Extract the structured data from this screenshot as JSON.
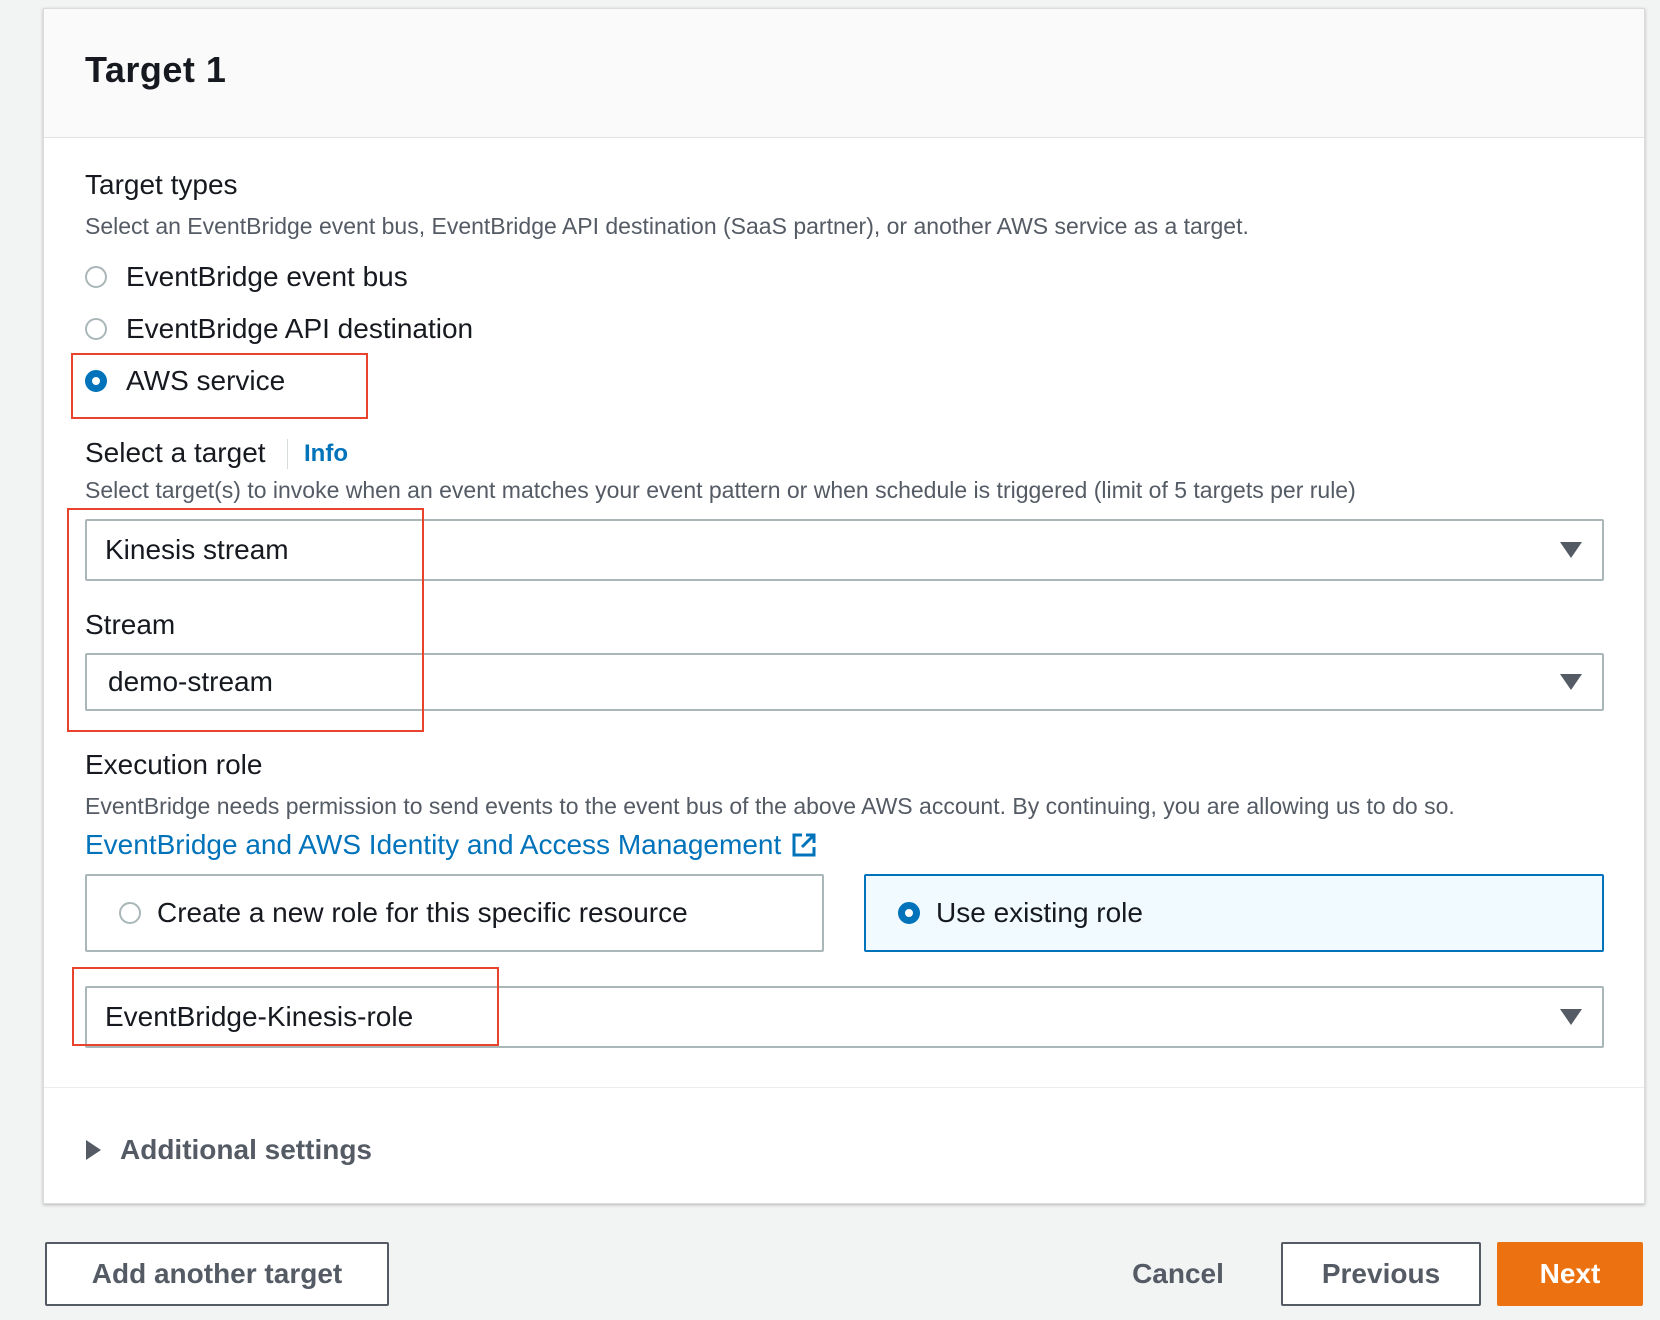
{
  "panel": {
    "title": "Target 1"
  },
  "target_types": {
    "label": "Target types",
    "description": "Select an EventBridge event bus, EventBridge API destination (SaaS partner), or another AWS service as a target.",
    "options": [
      {
        "label": "EventBridge event bus",
        "checked": false
      },
      {
        "label": "EventBridge API destination",
        "checked": false
      },
      {
        "label": "AWS service",
        "checked": true
      }
    ]
  },
  "select_target": {
    "label": "Select a target",
    "info_link": "Info",
    "description": "Select target(s) to invoke when an event matches your event pattern or when schedule is triggered (limit of 5 targets per rule)",
    "value": "Kinesis stream"
  },
  "stream": {
    "label": "Stream",
    "value": "demo-stream"
  },
  "execution_role": {
    "label": "Execution role",
    "description": "EventBridge needs permission to send events to the event bus of the above AWS account. By continuing, you are allowing us to do so.",
    "iam_link": "EventBridge and AWS Identity and Access Management",
    "tiles": [
      {
        "label": "Create a new role for this specific resource",
        "checked": false
      },
      {
        "label": "Use existing role",
        "checked": true
      }
    ],
    "role_value": "EventBridge-Kinesis-role"
  },
  "additional_settings": {
    "label": "Additional settings"
  },
  "footer": {
    "add_target": "Add another target",
    "cancel": "Cancel",
    "previous": "Previous",
    "next": "Next"
  },
  "colors": {
    "accent_blue": "#0073bb",
    "primary_orange": "#ec7211",
    "highlight_red": "#e8432c"
  },
  "icons": {
    "external_link": "external-link-icon",
    "dropdown_caret": "caret-down-icon",
    "expand": "caret-right-icon"
  }
}
